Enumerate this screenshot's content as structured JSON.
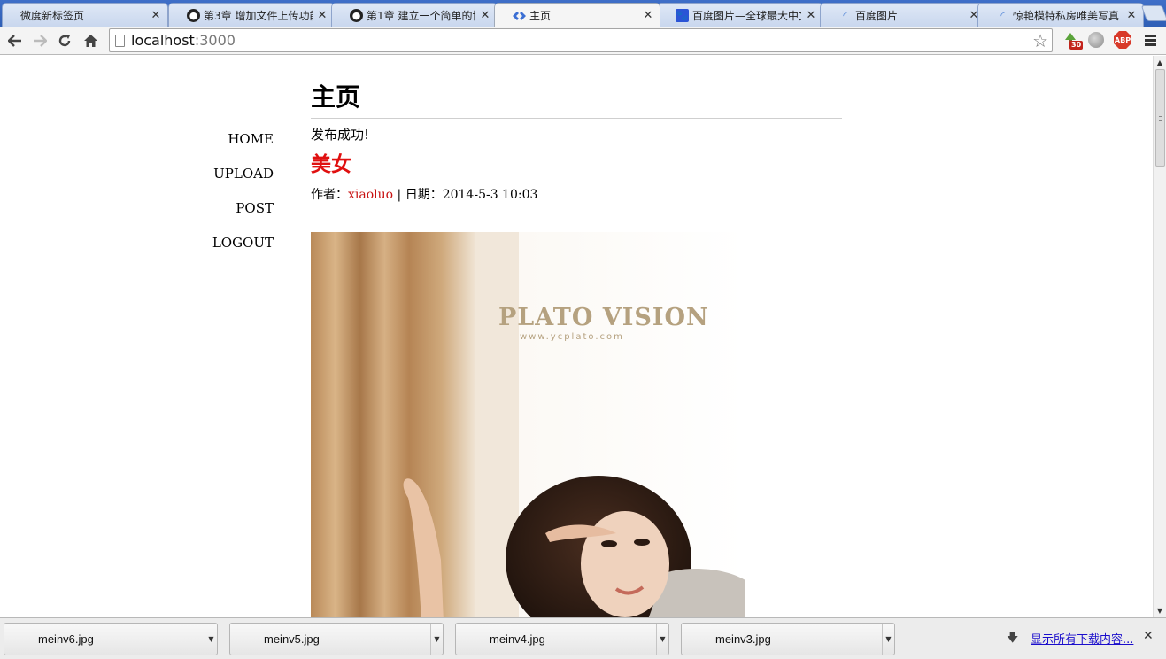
{
  "tabs": [
    {
      "title": "微度新标签页",
      "icon": "blank-icon",
      "active": false
    },
    {
      "title": "第3章 增加文件上传功能",
      "icon": "github-icon",
      "active": false
    },
    {
      "title": "第1章 建立一个简单的博",
      "icon": "github-icon",
      "active": false
    },
    {
      "title": "主页",
      "icon": "diamond-icon",
      "active": true
    },
    {
      "title": "百度图片—全球最大中文",
      "icon": "baidu-paw-icon",
      "active": false
    },
    {
      "title": "百度图片",
      "icon": "loading-icon",
      "active": false
    },
    {
      "title": "惊艳模特私房唯美写真",
      "icon": "loading-icon",
      "active": false
    }
  ],
  "toolbar": {
    "url_host": "localhost",
    "url_port": ":3000",
    "extension_badge": "30",
    "abp_label": "ABP"
  },
  "nav": {
    "home": "HOME",
    "upload": "UPLOAD",
    "post": "POST",
    "logout": "LOGOUT"
  },
  "main": {
    "page_title": "主页",
    "flash_message": "发布成功!",
    "post": {
      "title": "美女",
      "meta_author_label": "作者：",
      "author": "xiaoluo",
      "meta_date_label": " | 日期：",
      "date": "2014-5-3 10:03",
      "image_brand_text": "PLATO VISION",
      "image_brand_url": "www.ycplato.com"
    }
  },
  "downloads": {
    "items": [
      "meinv6.jpg",
      "meinv5.jpg",
      "meinv4.jpg",
      "meinv3.jpg"
    ],
    "show_all": "显示所有下载内容..."
  },
  "colors": {
    "post_title": "#e01010",
    "author_link": "#c81212",
    "show_all_link": "#1a0dcc"
  }
}
